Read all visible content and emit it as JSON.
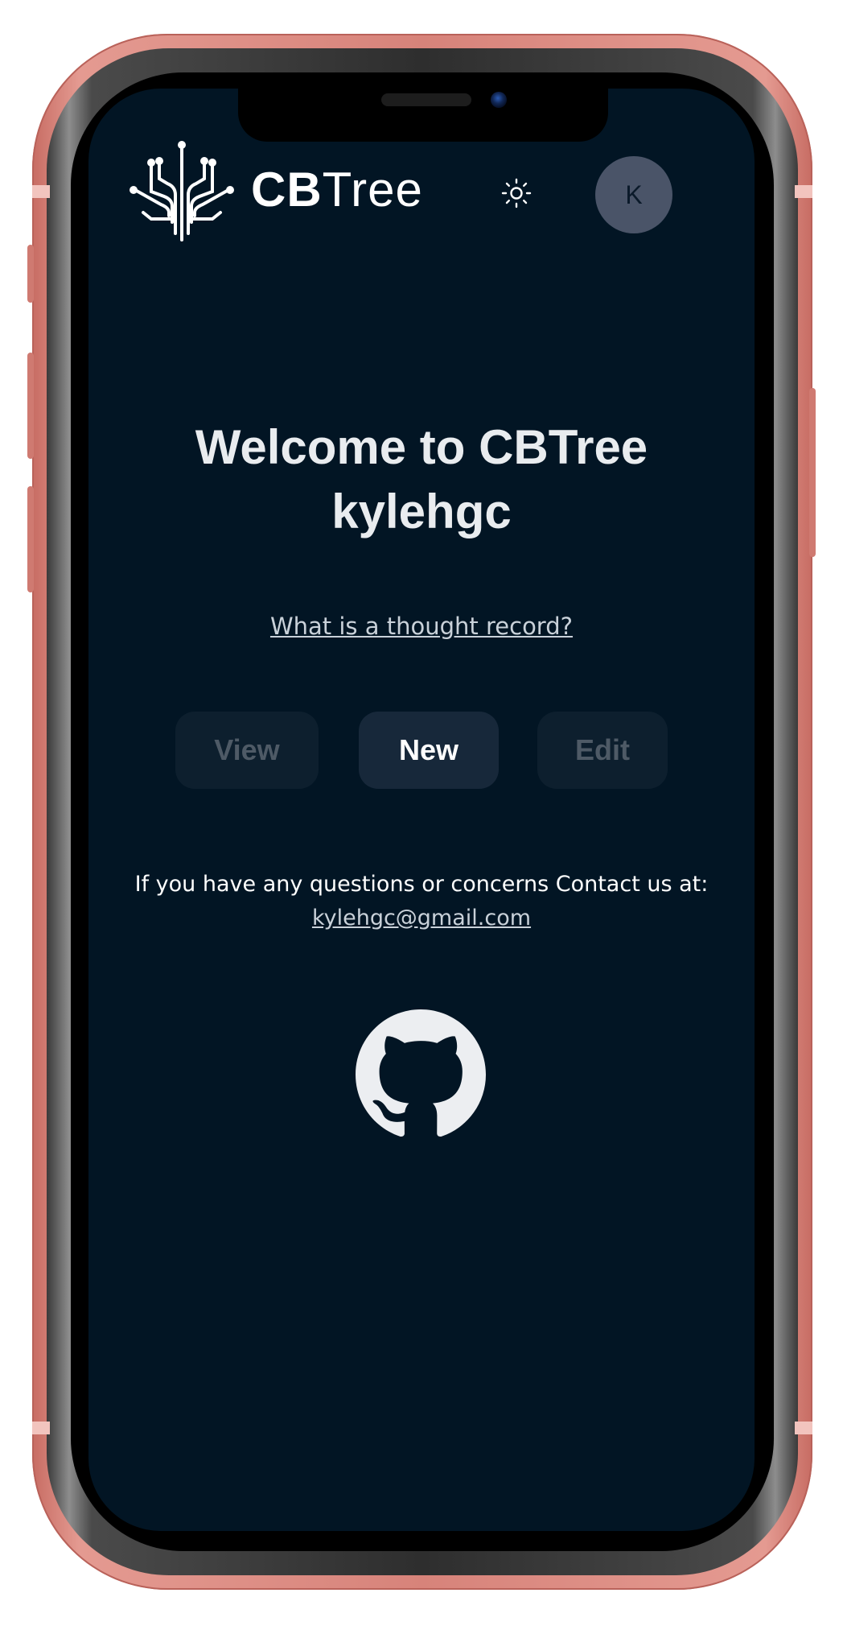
{
  "app": {
    "brand_bold": "CB",
    "brand_light": "Tree"
  },
  "header": {
    "theme_icon": "sun-icon",
    "avatar_initial": "K"
  },
  "main": {
    "welcome_line1": "Welcome to CBTree",
    "welcome_line2": "kylehgc",
    "thought_record_link": "What is a thought record?",
    "actions": {
      "view": "View",
      "new": "New",
      "edit": "Edit"
    },
    "contact_text": "If you have any questions or concerns Contact us at:",
    "contact_email": "kylehgc@gmail.com",
    "github_icon": "github-icon"
  },
  "colors": {
    "screen_background": "#021524",
    "phone_frame": "#d7837a",
    "button_active_bg": "#17283a",
    "button_disabled_bg": "#0d1f2e",
    "avatar_bg": "#4a5468"
  }
}
